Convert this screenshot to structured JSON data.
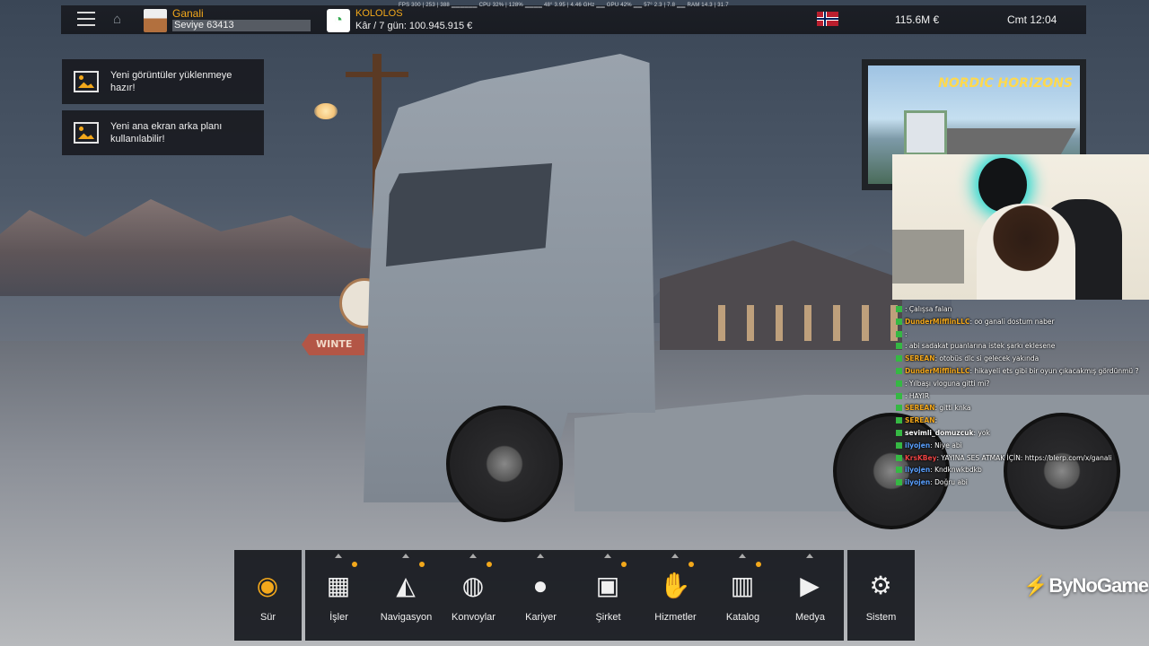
{
  "topbar": {
    "player_name": "Ganali",
    "level": "Seviye 63413",
    "company_name": "KOLOLOS",
    "company_profit": "Kâr / 7 gün: 100.945.915 €",
    "perf_stats": "FPS 300 | 253 | 388 ▁▁▁▁▁▁ CPU 32% | 128% ▁▁▁▁ 48° 3.95 | 4.46 GHz ▁▁ GPU 42% ▁▁ 57° 2.3 | 7.8 ▁▁ RAM 14.3 | 31.7",
    "money": "115.6M  €",
    "clock": "Cmt 12:04",
    "flag_colors": {
      "red": "#ba1f2e",
      "white": "#ffffff",
      "blue": "#00205b"
    }
  },
  "notifications": [
    {
      "text_line1": "Yeni görüntüler yüklenmeye",
      "text_line2": "hazır!"
    },
    {
      "text_line1": "Yeni ana ekran arka planı",
      "text_line2": "kullanılabilir!"
    }
  ],
  "scene": {
    "sign_text": "WINTE"
  },
  "stream": {
    "banner_title": "NORDIC HORIZONS",
    "brand_mark": "⚡",
    "brand": "ByNoGame"
  },
  "chat": [
    {
      "user": "",
      "color": "#e44",
      "msg": ": Çalışsa falan"
    },
    {
      "user": "DunderMifflinLLC",
      "color": "#f3a81b",
      "msg": ": oo ganali dostum naber"
    },
    {
      "user": "",
      "color": "#e44",
      "msg": ": "
    },
    {
      "user": "",
      "color": "#e44",
      "msg": ": abi sadakat puanlarına istek şarkı eklesene"
    },
    {
      "user": "SEREAN",
      "color": "#f3a81b",
      "msg": ": otobüs dlc si gelecek yakında"
    },
    {
      "user": "DunderMifflinLLC",
      "color": "#f3a81b",
      "msg": ": hikayeli ets gibi bir oyun çıkacakmış gördünmü ?"
    },
    {
      "user": "",
      "color": "#5aa0ff",
      "msg": ": Yılbaşı vloguna gitti mi?"
    },
    {
      "user": "",
      "color": "#e44",
      "msg": ": HAYIR"
    },
    {
      "user": "SEREAN",
      "color": "#f3a81b",
      "msg": ": gitti knka"
    },
    {
      "user": "SEREAN",
      "color": "#f3a81b",
      "msg": ": "
    },
    {
      "user": "sevimli_domuzcuk",
      "color": "#ffffff",
      "msg": ": yok"
    },
    {
      "user": "ilyojen",
      "color": "#5aa0ff",
      "msg": ": Niye abi"
    },
    {
      "user": "KrsKBey",
      "color": "#e44",
      "msg": ": YAYINA SES ATMAK İÇİN: https://blerp.com/x/ganali"
    },
    {
      "user": "ilyojen",
      "color": "#5aa0ff",
      "msg": ": Kndknwkbdkb"
    },
    {
      "user": "ilyojen",
      "color": "#5aa0ff",
      "msg": ": Doğru abi"
    }
  ],
  "dock": [
    {
      "label": "Sür",
      "icon": "steering-wheel-icon",
      "glyph": "◉",
      "caret": false,
      "dot": false
    },
    {
      "label": "İşler",
      "icon": "cargo-boxes-icon",
      "glyph": "▦",
      "caret": true,
      "dot": true
    },
    {
      "label": "Navigasyon",
      "icon": "map-pin-icon",
      "glyph": "◭",
      "caret": true,
      "dot": true
    },
    {
      "label": "Konvoylar",
      "icon": "globe-cursor-icon",
      "glyph": "◍",
      "caret": true,
      "dot": true
    },
    {
      "label": "Kariyer",
      "icon": "driver-profile-icon",
      "glyph": "●",
      "caret": true,
      "dot": false
    },
    {
      "label": "Şirket",
      "icon": "company-truck-icon",
      "glyph": "▣",
      "caret": true,
      "dot": true
    },
    {
      "label": "Hizmetler",
      "icon": "services-hand-icon",
      "glyph": "✋",
      "caret": true,
      "dot": true
    },
    {
      "label": "Katalog",
      "icon": "catalog-books-icon",
      "glyph": "▥",
      "caret": true,
      "dot": true
    },
    {
      "label": "Medya",
      "icon": "media-gallery-icon",
      "glyph": "▶",
      "caret": true,
      "dot": false
    },
    {
      "label": "Sistem",
      "icon": "gear-icon",
      "glyph": "⚙",
      "caret": false,
      "dot": false
    }
  ],
  "accent_color": "#f3a81b"
}
